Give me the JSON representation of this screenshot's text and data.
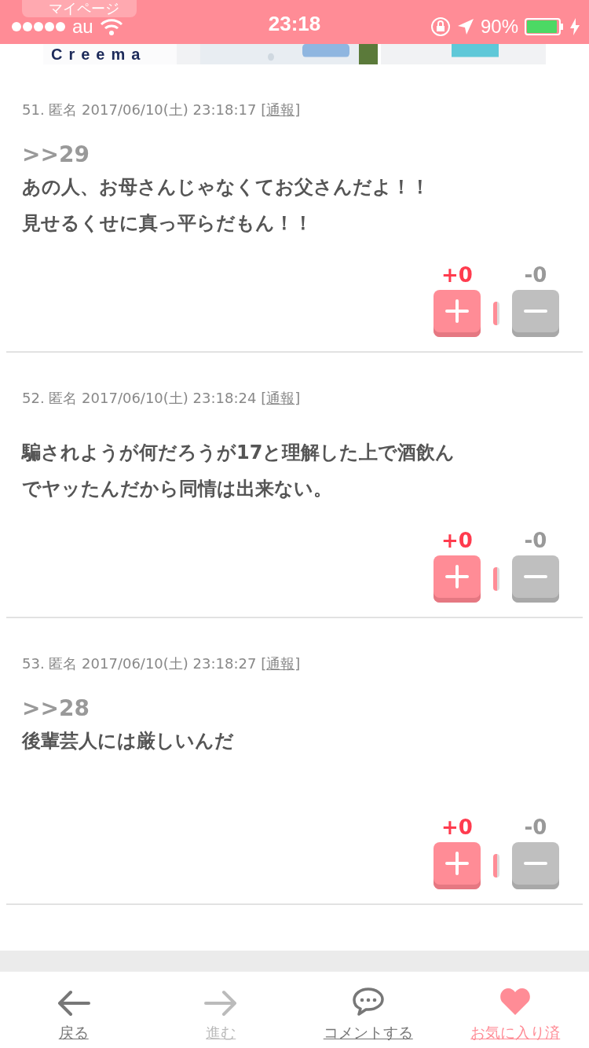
{
  "status_bar": {
    "carrier": "au",
    "time": "23:18",
    "battery": "90%",
    "back_pill": "マイページ"
  },
  "banner": {
    "logo": "Creema"
  },
  "comments": [
    {
      "meta_before": "51. 匿名 2017/06/10(土) 23:18:17 [",
      "report": "通報",
      "meta_after": "]",
      "reply_to": ">>29",
      "body": [
        "あの人、お母さんじゃなくてお父さんだよ！！",
        "見せるくせに真っ平らだもん！！"
      ],
      "plus": "+0",
      "minus": "-0"
    },
    {
      "meta_before": "52. 匿名 2017/06/10(土) 23:18:24 [",
      "report": "通報",
      "meta_after": "]",
      "body": [
        "騙されようが何だろうが17と理解した上で酒飲ん",
        "でヤッたんだから同情は出来ない。"
      ],
      "plus": "+0",
      "minus": "-0"
    },
    {
      "meta_before": "53. 匿名 2017/06/10(土) 23:18:27 [",
      "report": "通報",
      "meta_after": "]",
      "reply_to": ">>28",
      "body": [
        "後輩芸人には厳しいんだ"
      ],
      "plus": "+0",
      "minus": "-0"
    }
  ],
  "tab_bar": [
    {
      "kind": "back",
      "label": "戻る",
      "disabled": false
    },
    {
      "kind": "forward",
      "label": "進む",
      "disabled": true
    },
    {
      "kind": "comment",
      "label": "コメントする",
      "disabled": false
    },
    {
      "kind": "favorite",
      "label": "お気に入り済",
      "disabled": false
    }
  ]
}
